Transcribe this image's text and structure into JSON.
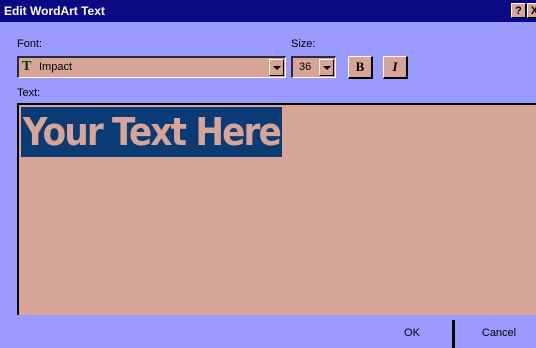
{
  "window": {
    "title": "Edit WordArt Text",
    "help_label": "?",
    "close_label": "X"
  },
  "font": {
    "label": "Font:",
    "selected": "Impact",
    "icon": "truetype-font-icon"
  },
  "size": {
    "label": "Size:",
    "selected": "36"
  },
  "format": {
    "bold_label": "B",
    "italic_label": "I"
  },
  "text": {
    "label": "Text:",
    "value": "Your Text Here"
  },
  "buttons": {
    "ok_label": "OK",
    "cancel_label": "Cancel"
  }
}
